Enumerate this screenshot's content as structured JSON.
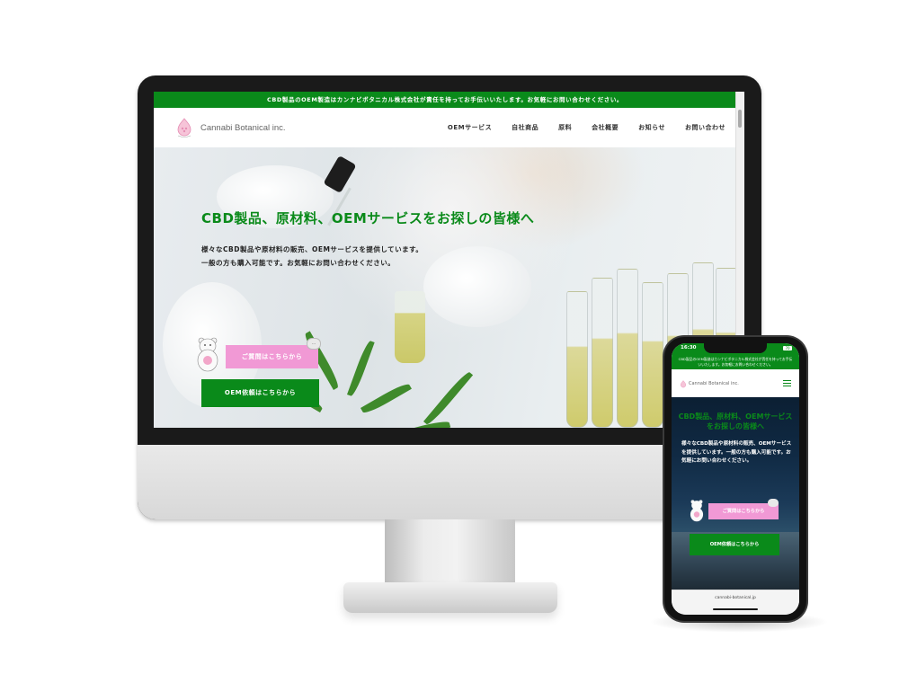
{
  "desktop": {
    "announcement": "CBD製品のOEM製造はカンナビボタニカル株式会社が責任を持ってお手伝いいたします。お気軽にお問い合わせください。",
    "logo_text": "Cannabi Botanical inc.",
    "nav": [
      {
        "label": "OEMサービス"
      },
      {
        "label": "自社商品"
      },
      {
        "label": "原料"
      },
      {
        "label": "会社概要"
      },
      {
        "label": "お知らせ"
      },
      {
        "label": "お問い合わせ"
      }
    ],
    "hero": {
      "title": "CBD製品、原材料、OEMサービスをお探しの皆様へ",
      "desc_lines": [
        "様々なCBD製品や原材料の販売、OEMサービスを提供しています。",
        "一般の方も購入可能です。お気軽にお問い合わせください。"
      ],
      "question_button": "ご質問はこちらから",
      "oem_button": "OEM依頼はこちらから"
    }
  },
  "phone": {
    "time": "16:30",
    "battery": "70",
    "announcement": "CBD製品のOEM製造はカンナビボタニカル株式会社が責任を持ってお手伝いいたします。お気軽にお問い合わせください。",
    "logo_text": "Cannabi Botanical inc.",
    "hero_title": "CBD製品、原材料、OEMサービスをお探しの皆様へ",
    "desc": "様々なCBD製品や原材料の販売、OEMサービスを提供しています。一般の方も購入可能です。お気軽にお問い合わせください。",
    "question_button": "ご質問はこちらから",
    "oem_button": "OEM依頼はこちらから",
    "url": "cannabi-botanical.jp"
  },
  "colors": {
    "brand_green": "#0a8a1a",
    "accent_pink": "#f199d5"
  }
}
